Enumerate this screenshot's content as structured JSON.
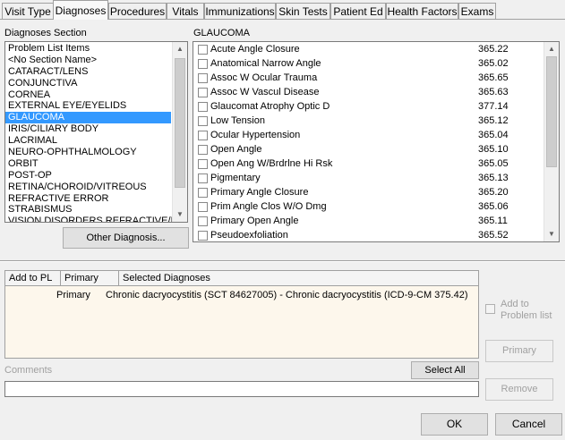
{
  "tabs": [
    {
      "label": "Visit Type",
      "active": false
    },
    {
      "label": "Diagnoses",
      "active": true
    },
    {
      "label": "Procedures",
      "active": false
    },
    {
      "label": "Vitals",
      "active": false
    },
    {
      "label": "Immunizations",
      "active": false
    },
    {
      "label": "Skin Tests",
      "active": false
    },
    {
      "label": "Patient Ed",
      "active": false
    },
    {
      "label": "Health Factors",
      "active": false
    },
    {
      "label": "Exams",
      "active": false
    }
  ],
  "sections": {
    "title": "Diagnoses Section",
    "selected": "GLAUCOMA",
    "items": [
      "Problem List Items",
      "<No Section Name>",
      "CATARACT/LENS",
      "CONJUNCTIVA",
      "CORNEA",
      "EXTERNAL EYE/EYELIDS",
      "GLAUCOMA",
      "IRIS/CILIARY BODY",
      "LACRIMAL",
      "NEURO-OPHTHALMOLOGY",
      "ORBIT",
      "POST-OP",
      "RETINA/CHOROID/VITREOUS",
      "REFRACTIVE ERROR",
      "STRABISMUS",
      "VISION DISORDERS REFRACTIVE/I"
    ]
  },
  "diagnoses": {
    "title": "GLAUCOMA",
    "items": [
      {
        "name": "Acute Angle Closure",
        "code": "365.22",
        "checked": false
      },
      {
        "name": "Anatomical Narrow Angle",
        "code": "365.02",
        "checked": false
      },
      {
        "name": "Assoc W Ocular Trauma",
        "code": "365.65",
        "checked": false
      },
      {
        "name": "Assoc W Vascul Disease",
        "code": "365.63",
        "checked": false
      },
      {
        "name": "Glaucomat Atrophy Optic D",
        "code": "377.14",
        "checked": false
      },
      {
        "name": "Low Tension",
        "code": "365.12",
        "checked": false
      },
      {
        "name": "Ocular Hypertension",
        "code": "365.04",
        "checked": false
      },
      {
        "name": "Open Angle",
        "code": "365.10",
        "checked": false
      },
      {
        "name": "Open Ang W/Brdrlne Hi Rsk",
        "code": "365.05",
        "checked": false
      },
      {
        "name": "Pigmentary",
        "code": "365.13",
        "checked": false
      },
      {
        "name": "Primary Angle Closure",
        "code": "365.20",
        "checked": false
      },
      {
        "name": "Prim Angle Clos W/O Dmg",
        "code": "365.06",
        "checked": false
      },
      {
        "name": "Primary Open Angle",
        "code": "365.11",
        "checked": false
      },
      {
        "name": "Pseudoexfoliation",
        "code": "365.52",
        "checked": false
      }
    ]
  },
  "other_diagnosis_label": "Other Diagnosis...",
  "selected_grid": {
    "headers": [
      "Add to PL",
      "Primary",
      "Selected Diagnoses"
    ],
    "rows": [
      {
        "add_to_pl": "",
        "primary": "Primary",
        "diagnosis": "Chronic dacryocystitis (SCT 84627005) - Chronic dacryocystitis (ICD-9-CM 375.42)"
      }
    ]
  },
  "add_to_problem_list_label": "Add to\nProblem list",
  "primary_button": "Primary",
  "remove_button": "Remove",
  "comments_label": "Comments",
  "comments_value": "",
  "select_all_button": "Select All",
  "ok_button": "OK",
  "cancel_button": "Cancel",
  "colors": {
    "selection": "#3399ff",
    "grid_background": "#fdf7ec",
    "window_background": "#f0f0f0"
  }
}
